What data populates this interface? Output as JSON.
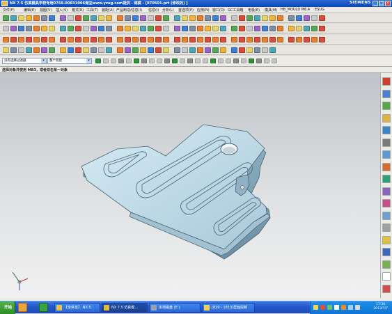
{
  "window": {
    "title": "NX 7.5 仿真模具学校专用0769-00831066淘宝www.yzug.com提供 - 建模 - [070501.prt (修改的) ]",
    "brand": "SIEMENS",
    "minimize": "_",
    "maximize": "□",
    "close": "×"
  },
  "menu": [
    "文件(F)",
    "编辑(E)",
    "视图(V)",
    "插入(S)",
    "格式(R)",
    "工具(T)",
    "装配(A)",
    "产品制造/信息(I)",
    "信息(I)",
    "分析(L)",
    "首选项(P)",
    "应用(N)",
    "窗口(O)",
    "GC工具箱",
    "电极(E)",
    "模具(M)",
    "HB_MOULD M6.4",
    "ESUG"
  ],
  "selection_bar": {
    "filter_value": "没有选择过滤器",
    "scope_value": "整个装配"
  },
  "cue_line": "选择对象并使用 MB3，或者双击某一对象",
  "taskbar": {
    "start": "开始",
    "tasks": [
      "【全纵览】 NX 5.",
      "NX 7.5 仿真模…",
      "本地磁盘 (E:)",
      "(820 - 1813)型面控制"
    ],
    "time": "17:36",
    "date": "2013/7/7"
  },
  "colors": {
    "title_blue": "#0b46b8",
    "viewport_top": "#c0c4c8",
    "part_face": "#bcd8e6",
    "taskbar_blue": "#2458c8"
  }
}
